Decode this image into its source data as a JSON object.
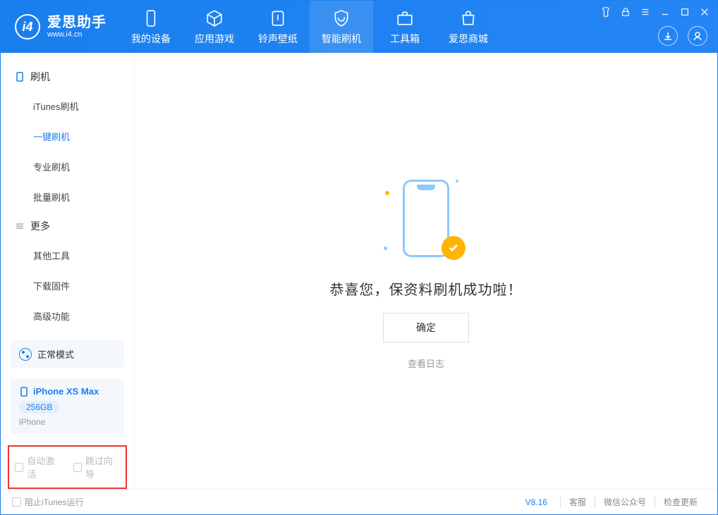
{
  "app": {
    "name": "爱思助手",
    "url": "www.i4.cn"
  },
  "tabs": {
    "device": "我的设备",
    "apps": "应用游戏",
    "ringtones": "铃声壁纸",
    "flash": "智能刷机",
    "toolbox": "工具箱",
    "store": "爱思商城"
  },
  "sidebar": {
    "group_flash": "刷机",
    "items_flash": {
      "itunes": "iTunes刷机",
      "oneclick": "一键刷机",
      "pro": "专业刷机",
      "batch": "批量刷机"
    },
    "group_more": "更多",
    "items_more": {
      "other": "其他工具",
      "firmware": "下载固件",
      "advanced": "高级功能"
    }
  },
  "mode": {
    "label": "正常模式"
  },
  "device": {
    "name": "iPhone XS Max",
    "capacity": "256GB",
    "type": "iPhone"
  },
  "checks": {
    "auto_activate": "自动激活",
    "skip_guide": "跳过向导"
  },
  "main": {
    "success": "恭喜您，保资料刷机成功啦！",
    "ok": "确定",
    "view_log": "查看日志"
  },
  "footer": {
    "block_itunes": "阻止iTunes运行",
    "version": "V8.16",
    "support": "客服",
    "wechat": "微信公众号",
    "update": "检查更新"
  }
}
